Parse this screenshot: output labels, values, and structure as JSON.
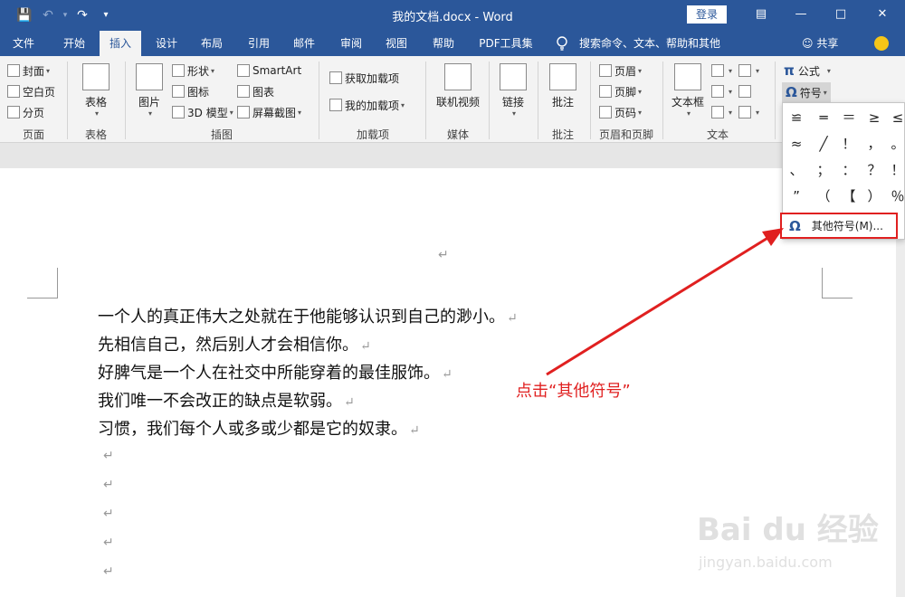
{
  "window": {
    "title": "我的文档.docx - Word",
    "login_label": "登录",
    "ribbon_display_icon": "ribbon-display-options-icon",
    "minimize_icon": "minimize-icon",
    "maximize_icon": "maximize-icon",
    "close_icon": "close-icon"
  },
  "qat": {
    "save_icon": "save-icon",
    "undo_icon": "undo-icon",
    "redo_icon": "redo-icon",
    "customize_icon": "customize-qat-icon"
  },
  "tabs": [
    {
      "label": "文件"
    },
    {
      "label": "开始"
    },
    {
      "label": "插入"
    },
    {
      "label": "设计"
    },
    {
      "label": "布局"
    },
    {
      "label": "引用"
    },
    {
      "label": "邮件"
    },
    {
      "label": "审阅"
    },
    {
      "label": "视图"
    },
    {
      "label": "帮助"
    },
    {
      "label": "PDF工具集"
    }
  ],
  "tell_me": "搜索命令、文本、帮助和其他",
  "share_label": "共享",
  "ribbon": {
    "pages": {
      "cover": "封面",
      "blank": "空白页",
      "break": "分页",
      "group": "页面"
    },
    "tables": {
      "table": "表格",
      "group": "表格"
    },
    "illustrations": {
      "picture": "图片",
      "shapes": "形状",
      "icons": "图标",
      "model3d": "3D 模型",
      "smartart": "SmartArt",
      "chart": "图表",
      "screenshot": "屏幕截图",
      "group": "插图"
    },
    "addins": {
      "get": "获取加载项",
      "mine": "我的加载项",
      "group": "加载项"
    },
    "media": {
      "video": "联机视频",
      "group": "媒体"
    },
    "links": {
      "link": "链接"
    },
    "comments": {
      "comment": "批注",
      "group": "批注"
    },
    "header_footer": {
      "header": "页眉",
      "footer": "页脚",
      "page_number": "页码",
      "group": "页眉和页脚"
    },
    "text": {
      "textbox": "文本框",
      "group": "文本"
    },
    "symbols": {
      "equation": "公式",
      "symbol": "符号"
    }
  },
  "symbol_panel": {
    "symbols": [
      "≌",
      "═",
      "＝",
      "≥",
      "≤",
      "≈",
      "╱",
      "！",
      "，",
      "。",
      "、",
      "；",
      "：",
      "？",
      "！",
      "”",
      "（",
      "【",
      "）",
      "％"
    ],
    "more_label": "其他符号(M)..."
  },
  "document": {
    "lines": [
      "一个人的真正伟大之处就在于他能够认识到自己的渺小。",
      "先相信自己，然后别人才会相信你。",
      "好脾气是一个人在社交中所能穿着的最佳服饰。",
      "我们唯一不会改正的缺点是软弱。",
      "习惯，我们每个人或多或少都是它的奴隶。"
    ],
    "paragraph_mark": "↵"
  },
  "annotation": {
    "text": "点击“其他符号”",
    "color": "#e02020"
  },
  "watermark": {
    "main": "Bai du 经验",
    "sub": "jingyan.baidu.com"
  },
  "colors": {
    "accent": "#2b579a",
    "highlight": "#e02020"
  }
}
